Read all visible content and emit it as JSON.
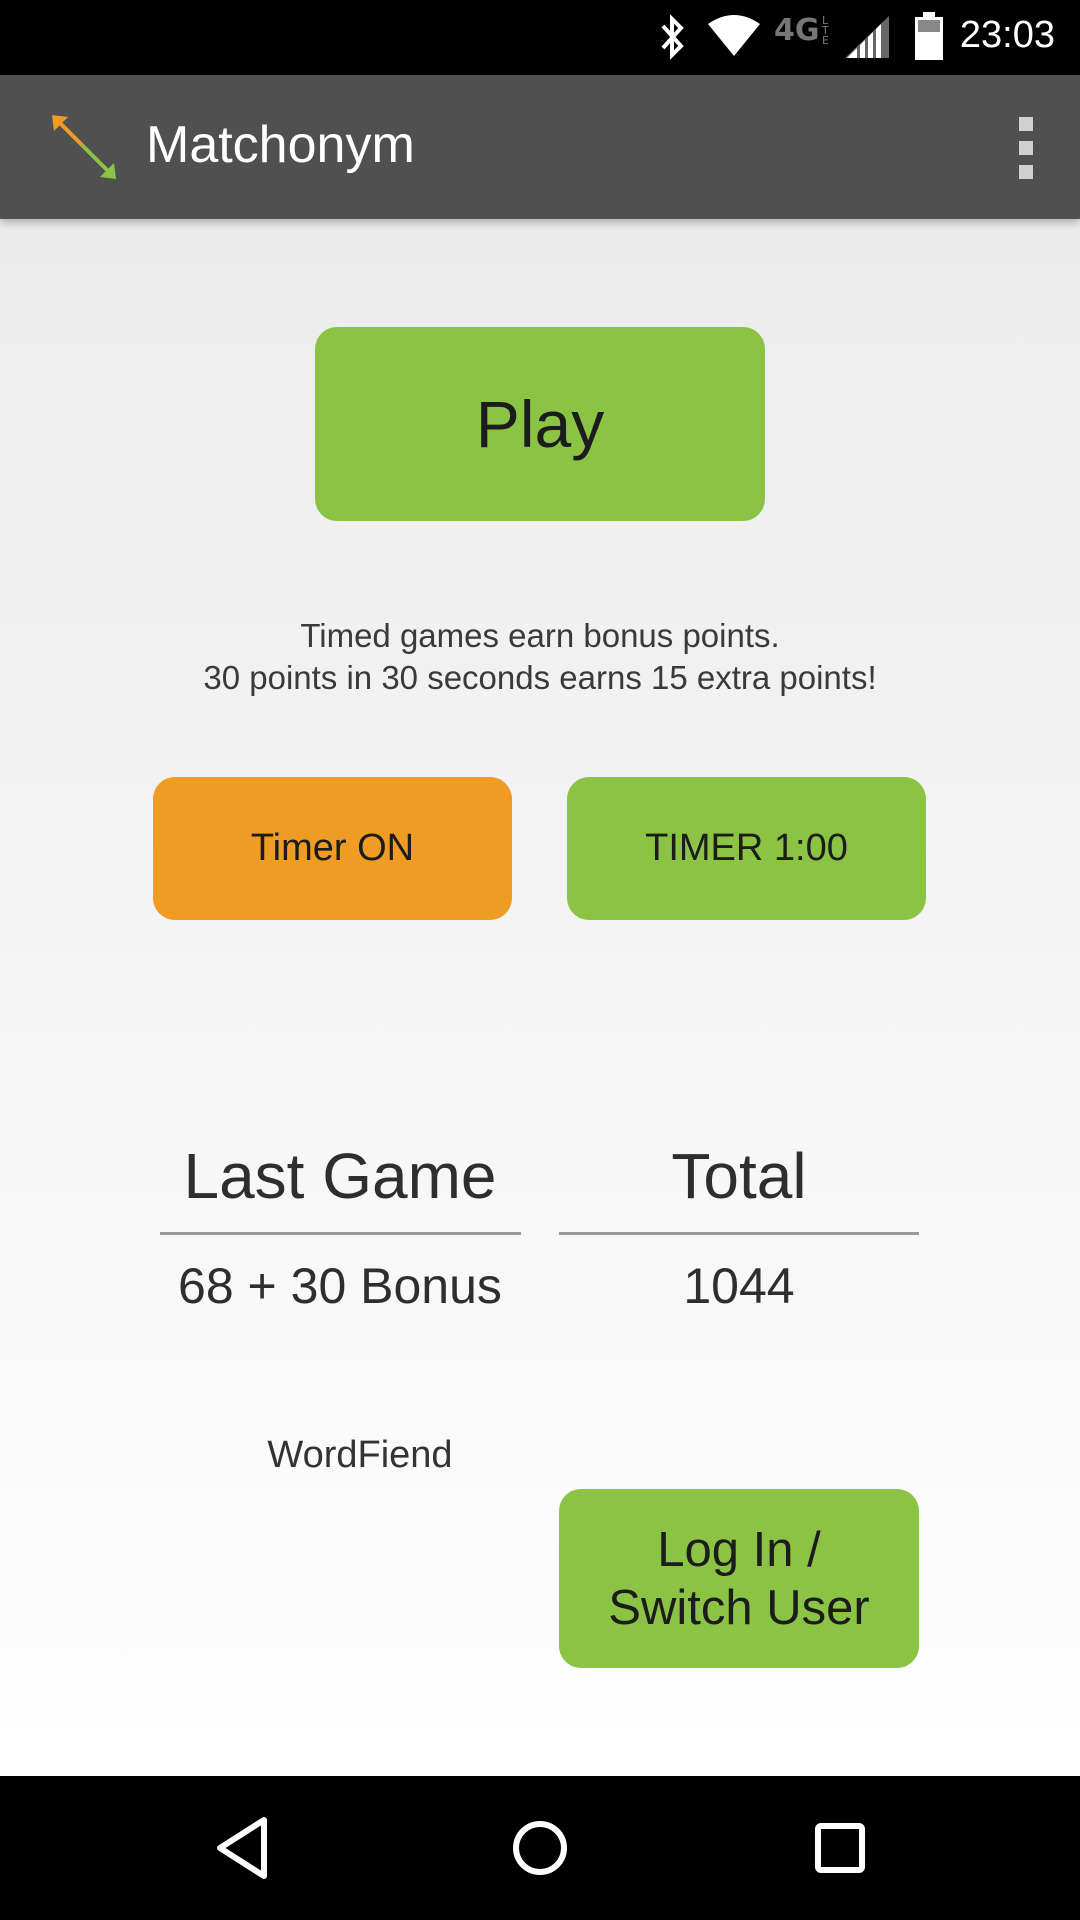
{
  "status_bar": {
    "time": "23:03",
    "network_label": "4G LTE",
    "icons": [
      "bluetooth-icon",
      "wifi-icon",
      "network-4g-icon",
      "cell-signal-icon",
      "battery-icon"
    ]
  },
  "app_bar": {
    "title": "Matchonym",
    "logo_icon": "matchonym-arrows-icon",
    "menu_icon": "overflow-menu-icon"
  },
  "main": {
    "play_label": "Play",
    "info_line1": "Timed games earn bonus points.",
    "info_line2": "30 points in 30 seconds earns 15 extra points!",
    "timer_toggle_label": "Timer ON",
    "timer_duration_label": "TIMER 1:00",
    "last_game_heading": "Last Game",
    "last_game_value": "68 + 30 Bonus",
    "total_heading": "Total",
    "total_value": "1044",
    "username": "WordFiend",
    "login_line1": "Log In /",
    "login_line2": "Switch User"
  },
  "nav_bar": {
    "icons": [
      "back-icon",
      "home-icon",
      "recents-icon"
    ]
  },
  "colors": {
    "accent_green": "#8bc444",
    "accent_orange": "#ee9c24",
    "app_bar": "#505050"
  }
}
